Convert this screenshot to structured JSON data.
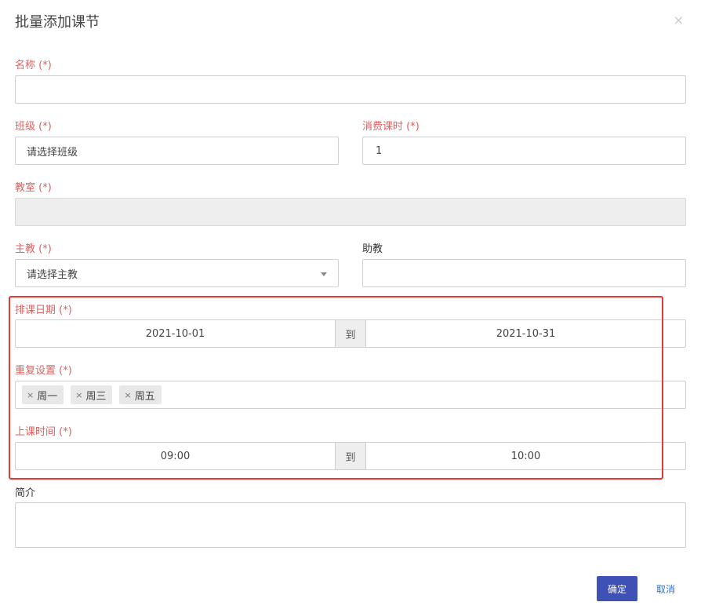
{
  "dialog": {
    "title": "批量添加课节",
    "close_glyph": "×"
  },
  "fields": {
    "name": {
      "label": "名称 (*)",
      "value": ""
    },
    "class": {
      "label": "班级 (*)",
      "value": "请选择班级"
    },
    "hours": {
      "label": "消费课时 (*)",
      "value": "1"
    },
    "classroom": {
      "label": "教室 (*)",
      "value": ""
    },
    "teacher": {
      "label": "主教 (*)",
      "value": "请选择主教"
    },
    "assistant": {
      "label": "助教",
      "value": ""
    },
    "date_range": {
      "label": "排课日期 (*)",
      "start": "2021-10-01",
      "separator": "到",
      "end": "2021-10-31"
    },
    "repeat": {
      "label": "重复设置 (*)",
      "tags": [
        "周一",
        "周三",
        "周五"
      ],
      "remove_glyph": "×"
    },
    "time_range": {
      "label": "上课时间 (*)",
      "start": "09:00",
      "separator": "到",
      "end": "10:00"
    },
    "intro": {
      "label": "简介",
      "value": ""
    }
  },
  "footer": {
    "ok_label": "确定",
    "cancel_label": "取消"
  },
  "colors": {
    "required_label": "#e06060",
    "primary": "#3f51b5",
    "link": "#2d6fd1",
    "highlight": "#e53935"
  }
}
